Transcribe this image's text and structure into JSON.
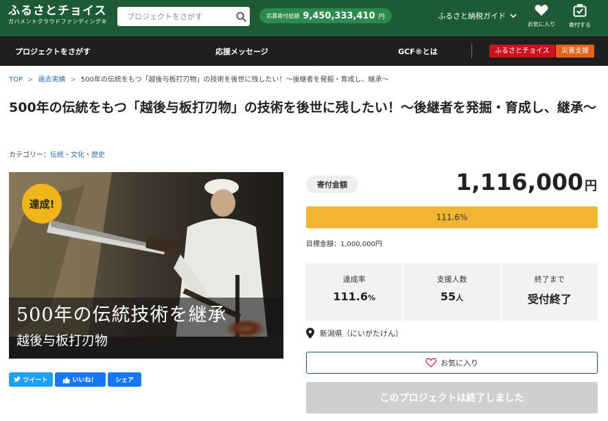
{
  "header": {
    "logo_main": "ふるさとチョイス",
    "logo_sub": "ガバメントクラウドファンディング®",
    "search_placeholder": "プロジェクトをさがす",
    "total_label": "応募寄付総額",
    "total_value": "9,450,333,410",
    "total_unit": "円",
    "guide_label": "ふるさと納税ガイド",
    "favorites_label": "お気に入り",
    "donate_label": "寄付する"
  },
  "nav": {
    "items": [
      "プロジェクトをさがす",
      "応援メッセージ",
      "GCF®とは"
    ],
    "badge_choice": "ふるさとチョイス",
    "badge_disaster": "災害支援",
    "badge_choice_color": "#c8141e",
    "badge_disaster_color": "#e0631a"
  },
  "breadcrumb": {
    "top": "TOP",
    "past": "過去実績",
    "current": "500年の伝統をもつ「越後与板打刃物」の技術を後世に残したい！〜後継者を発掘・育成し、継承〜"
  },
  "project": {
    "title": "500年の伝統をもつ「越後与板打刃物」の技術を後世に残したい！〜後継者を発掘・育成し、継承〜",
    "category_label": "カテゴリー：",
    "category_value": "伝統・文化・歴史",
    "image_badge": "達成!",
    "image_main_text": "500年の伝統技術を継承",
    "image_sub_text": "越後与板打刃物"
  },
  "social": {
    "tweet": "ツイート",
    "like": "いいね！",
    "share": "シェア"
  },
  "funding": {
    "amount_label": "寄付金額",
    "amount_value": "1,116,000",
    "amount_unit": "円",
    "progress_text": "111.6%",
    "progress_fraction": 1.0,
    "goal_text": "目標金額：1,000,000円",
    "stats": {
      "rate_label": "達成率",
      "rate_value": "111.6",
      "rate_unit": "%",
      "supporters_label": "支援人数",
      "supporters_value": "55",
      "supporters_unit": "人",
      "remaining_label": "終了まで",
      "remaining_value": "受付終了"
    },
    "location": "新潟県（にいがたけん）",
    "favorite_button": "お気に入り",
    "ended_button": "このプロジェクトは終了しました"
  },
  "colors": {
    "header_green": "#1d5a36",
    "accent_yellow": "#f2b431",
    "link_blue": "#2f6bb0"
  },
  "icons": [
    "search-icon",
    "chevron-down-icon",
    "heart-icon",
    "gift-icon",
    "location-pin-icon",
    "twitter-bird-icon",
    "thumbs-up-icon"
  ]
}
